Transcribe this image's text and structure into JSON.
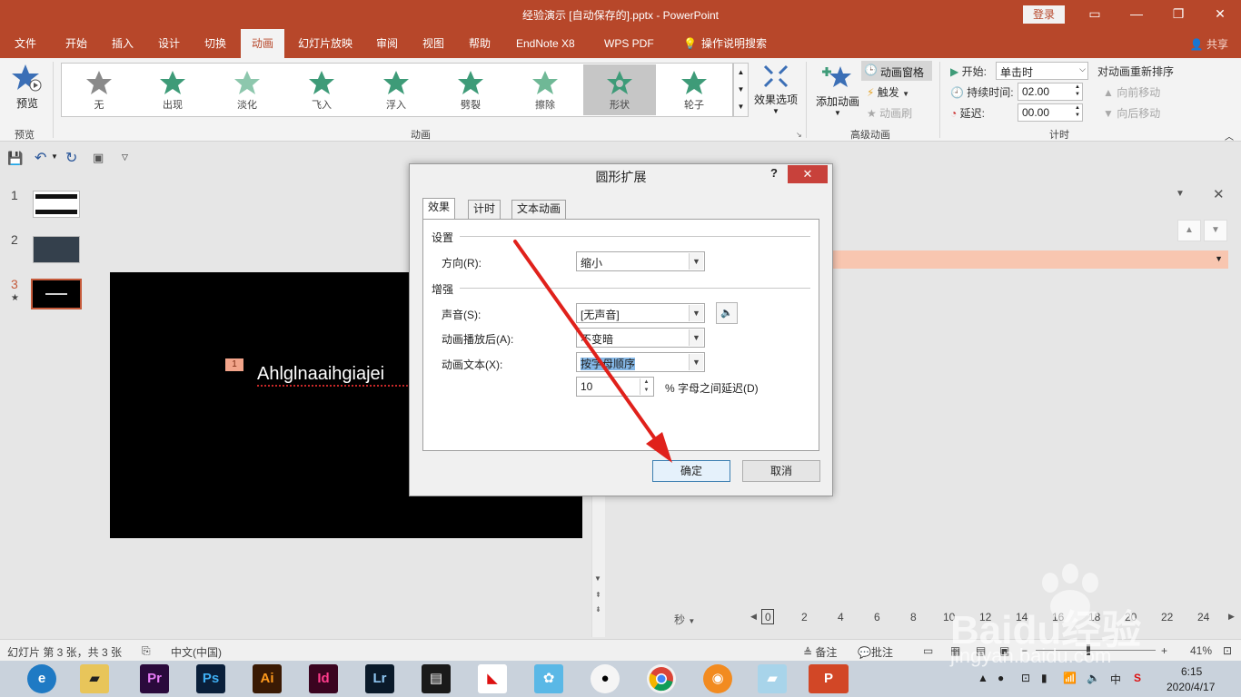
{
  "window": {
    "title": "经验演示 [自动保存的].pptx - PowerPoint",
    "login_label": "登录",
    "share_label": "共享"
  },
  "ribbon_tabs": [
    "文件",
    "开始",
    "插入",
    "设计",
    "切换",
    "动画",
    "幻灯片放映",
    "审阅",
    "视图",
    "帮助",
    "EndNote X8",
    "WPS PDF",
    "操作说明搜索"
  ],
  "ribbon": {
    "preview": {
      "label": "预览",
      "group": "预览"
    },
    "animation_gallery": [
      "无",
      "出现",
      "淡化",
      "飞入",
      "浮入",
      "劈裂",
      "擦除",
      "形状",
      "轮子"
    ],
    "selected_animation": "形状",
    "effect_options": "效果选项",
    "animation_group": "动画",
    "advanced": {
      "add_animation": "添加动画",
      "pane": "动画窗格",
      "trigger": "触发",
      "painter": "动画刷",
      "group": "高级动画"
    },
    "timing": {
      "start_label": "开始:",
      "start_value": "单击时",
      "duration_label": "持续时间:",
      "duration_value": "02.00",
      "delay_label": "延迟:",
      "delay_value": "00.00",
      "reorder": "对动画重新排序",
      "move_earlier": "向前移动",
      "move_later": "向后移动",
      "group": "计时"
    }
  },
  "slides": [
    {
      "number": "1"
    },
    {
      "number": "2"
    },
    {
      "number": "3",
      "star": "★"
    }
  ],
  "slide": {
    "anim_tag": "1",
    "text": "Ahlglnaaihgiajei"
  },
  "dialog": {
    "title": "圆形扩展",
    "help": "?",
    "close": "✕",
    "tabs": [
      "效果",
      "计时",
      "文本动画"
    ],
    "settings_label": "设置",
    "direction_label": "方向(R):",
    "direction_value": "缩小",
    "enhance_label": "增强",
    "sound_label": "声音(S):",
    "sound_value": "[无声音]",
    "after_label": "动画播放后(A):",
    "after_value": "不变暗",
    "text_label": "动画文本(X):",
    "text_value": "按字母顺序",
    "delay_value": "10",
    "delay_suffix": "% 字母之间延迟(D)",
    "ok": "确定",
    "cancel": "取消"
  },
  "anim_pane": {
    "seconds_label": "秒",
    "timeline": [
      "0",
      "2",
      "4",
      "6",
      "8",
      "10",
      "12",
      "14",
      "16",
      "18",
      "20",
      "22",
      "24"
    ]
  },
  "status": {
    "slide_info": "幻灯片 第 3 张，共 3 张",
    "language": "中文(中国)",
    "notes": "备注",
    "comments": "批注",
    "zoom": "41%"
  },
  "taskbar": {
    "apps": [
      "Pr",
      "Ps",
      "Ai",
      "Id",
      "Lr"
    ],
    "ime": "中",
    "time": "6:15",
    "date": "2020/4/17"
  },
  "watermark": {
    "brand": "Baidu",
    "suffix": "经验",
    "url": "jingyan.baidu.com"
  },
  "colors": {
    "accent": "#b7472a",
    "arrow": "#e0211b",
    "highlight": "#84b7e6"
  }
}
